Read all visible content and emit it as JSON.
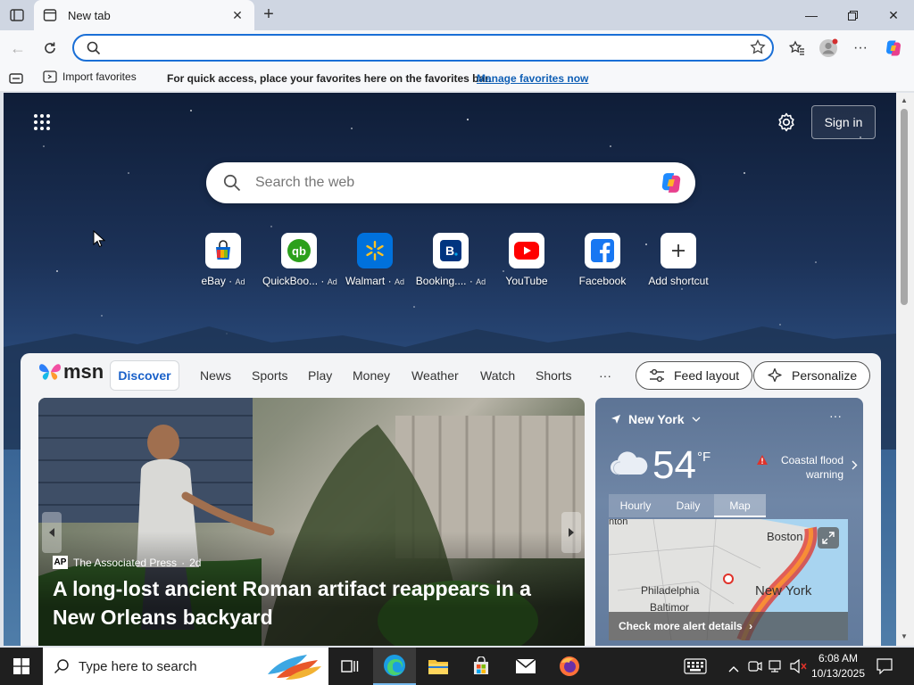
{
  "browser": {
    "tab_title": "New tab",
    "address_value": "",
    "favorites_bar": {
      "import_label": "Import favorites",
      "message": "For quick access, place your favorites here on the favorites bar.",
      "manage_link": "Manage favorites now"
    }
  },
  "newtab": {
    "sign_in_label": "Sign in",
    "search_placeholder": "Search the web",
    "shortcuts": [
      {
        "label": "eBay",
        "ad": "Ad",
        "icon": "ebay-icon"
      },
      {
        "label": "QuickBoo...",
        "ad": "Ad",
        "icon": "quickbooks-icon"
      },
      {
        "label": "Walmart",
        "ad": "Ad",
        "icon": "walmart-icon"
      },
      {
        "label": "Booking....",
        "ad": "Ad",
        "icon": "booking-icon"
      },
      {
        "label": "YouTube",
        "ad": "",
        "icon": "youtube-icon"
      },
      {
        "label": "Facebook",
        "ad": "",
        "icon": "facebook-icon"
      },
      {
        "label": "Add shortcut",
        "ad": "",
        "icon": "plus-icon"
      }
    ]
  },
  "feed": {
    "brand": "msn",
    "tabs": [
      "Discover",
      "News",
      "Sports",
      "Play",
      "Money",
      "Weather",
      "Watch",
      "Shorts"
    ],
    "more": "···",
    "feed_layout_label": "Feed layout",
    "personalize_label": "Personalize",
    "hero": {
      "source_logo": "AP",
      "source": "The Associated Press",
      "age": "2d",
      "headline": "A long-lost ancient Roman artifact reappears in a New Orleans backyard"
    },
    "weather": {
      "location": "New York",
      "temperature": "54",
      "unit": "°F",
      "alert_line1": "Coastal flood",
      "alert_line2": "warning",
      "tabs": [
        "Hourly",
        "Daily",
        "Map"
      ],
      "active_tab": "Map",
      "map_labels": [
        "Boston",
        "Philadelphia",
        "Baltimor",
        "New York",
        "nton"
      ],
      "alert_details": "Check more alert details"
    }
  },
  "taskbar": {
    "search_placeholder": "Type here to search",
    "time": "6:08 AM",
    "date": "10/13/2025"
  },
  "colors": {
    "accent": "#1a6fd6",
    "link": "#0f5fb5",
    "msn_blue": "#1a61c9",
    "alert_red": "#e0322a"
  }
}
